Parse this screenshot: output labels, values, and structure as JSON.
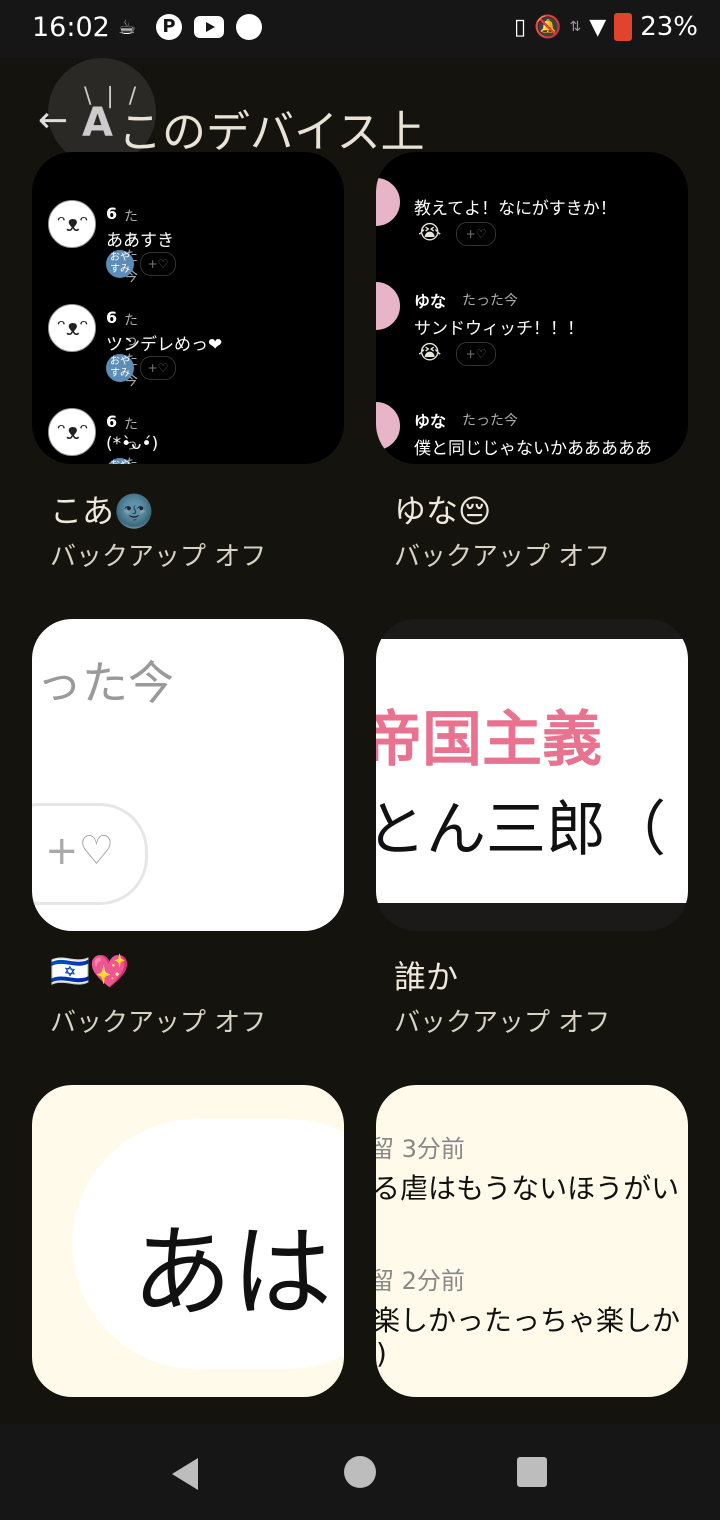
{
  "status": {
    "time": "16:02",
    "battery": "23%",
    "icons": [
      "coffee-icon",
      "pinterest-icon",
      "youtube-icon",
      "circle-icon",
      "nfc-icon",
      "bell-off-icon",
      "data-arrows-icon",
      "wifi-icon",
      "battery-icon"
    ]
  },
  "header": {
    "back_icon": "←",
    "title": "このデバイス上",
    "a11y_glyph": "A"
  },
  "cards": [
    {
      "name": "こあ🌚",
      "subtitle": "バックアップ オフ",
      "messages": [
        {
          "name": "6",
          "time": "たった今",
          "text": "ああすき",
          "sticker": "おや\nすみ",
          "react": "+♡"
        },
        {
          "name": "6",
          "time": "たった今",
          "text": "ツンデレめっ❤",
          "sticker": "おや\nすみ",
          "react": "+♡"
        },
        {
          "name": "6",
          "time": "たった今",
          "text": "(*•̀ᴗ•́)",
          "sticker": "おや",
          "react": ""
        }
      ]
    },
    {
      "name": "ゆな😔",
      "subtitle": "バックアップ オフ",
      "messages": [
        {
          "name": "",
          "time": "",
          "text": "教えてよ！なにがすきか！",
          "emoji": "😭",
          "react": "+♡"
        },
        {
          "name": "ゆな",
          "time": "たった今",
          "text": "サンドウィッチ！！！",
          "emoji": "😭",
          "react": "+♡"
        },
        {
          "name": "ゆな",
          "time": "たった今",
          "text": "僕と同じじゃないかあああああ",
          "emoji": "",
          "react": ""
        }
      ]
    },
    {
      "name": "🇮🇱💖",
      "subtitle": "バックアップ オフ",
      "snippet_time": "った今",
      "snippet_react": "+♡"
    },
    {
      "name": "誰か",
      "subtitle": "バックアップ オフ",
      "line1": "帝国主義",
      "line2": "とん三郎（"
    },
    {
      "name": "",
      "subtitle": "",
      "big": "あは"
    },
    {
      "name": "",
      "subtitle": "",
      "rows": [
        {
          "time": "3分前",
          "text": "る虐はもうないほうがい"
        },
        {
          "time": "2分前",
          "text": "楽しかったっちゃ楽しか"
        },
        {
          "time": "",
          "text": ")"
        }
      ]
    }
  ],
  "colors": {
    "background": "#15130d",
    "pink_text": "#e8728f"
  },
  "nav": {
    "back": "back",
    "home": "home",
    "recents": "recents"
  }
}
